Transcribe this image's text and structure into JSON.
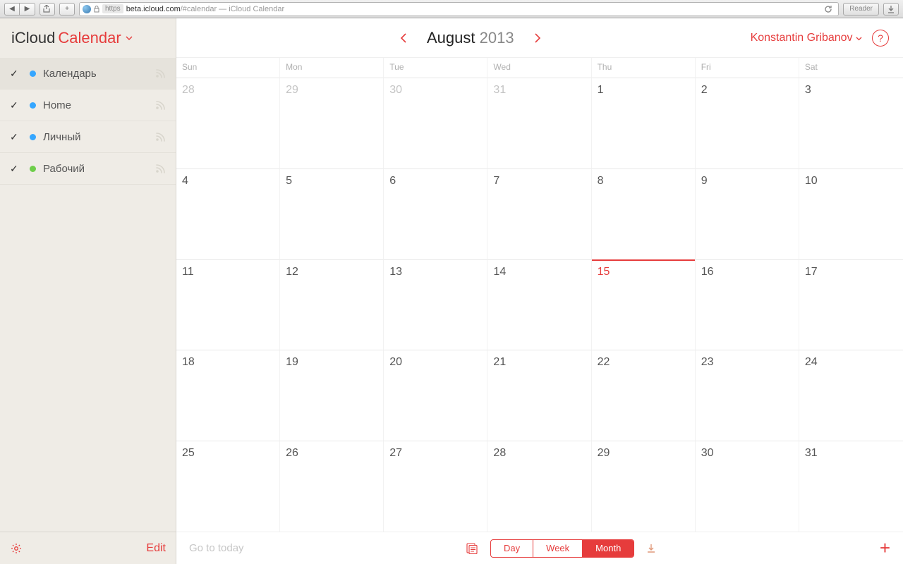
{
  "browser": {
    "scheme": "https",
    "host": "beta.icloud.com",
    "path": "/#calendar",
    "title_suffix": " — iCloud Calendar",
    "reader_label": "Reader"
  },
  "header": {
    "brand": "iCloud",
    "app_name": "Calendar"
  },
  "sidebar": {
    "calendars": [
      {
        "label": "Календарь",
        "color": "blue",
        "checked": true
      },
      {
        "label": "Home",
        "color": "blue",
        "checked": true
      },
      {
        "label": "Личный",
        "color": "blue",
        "checked": true
      },
      {
        "label": "Рабочий",
        "color": "green",
        "checked": true
      }
    ],
    "edit_label": "Edit"
  },
  "main": {
    "month": "August",
    "year": "2013",
    "username": "Konstantin Gribanov",
    "help": "?",
    "dow": [
      "Sun",
      "Mon",
      "Tue",
      "Wed",
      "Thu",
      "Fri",
      "Sat"
    ],
    "go_today": "Go to today",
    "views": {
      "day": "Day",
      "week": "Week",
      "month": "Month",
      "active": "month"
    },
    "grid": [
      {
        "n": "28",
        "other": true
      },
      {
        "n": "29",
        "other": true
      },
      {
        "n": "30",
        "other": true
      },
      {
        "n": "31",
        "other": true
      },
      {
        "n": "1"
      },
      {
        "n": "2"
      },
      {
        "n": "3"
      },
      {
        "n": "4"
      },
      {
        "n": "5"
      },
      {
        "n": "6"
      },
      {
        "n": "7"
      },
      {
        "n": "8"
      },
      {
        "n": "9"
      },
      {
        "n": "10"
      },
      {
        "n": "11"
      },
      {
        "n": "12"
      },
      {
        "n": "13"
      },
      {
        "n": "14"
      },
      {
        "n": "15",
        "today": true
      },
      {
        "n": "16"
      },
      {
        "n": "17"
      },
      {
        "n": "18"
      },
      {
        "n": "19"
      },
      {
        "n": "20"
      },
      {
        "n": "21"
      },
      {
        "n": "22"
      },
      {
        "n": "23"
      },
      {
        "n": "24"
      },
      {
        "n": "25"
      },
      {
        "n": "26"
      },
      {
        "n": "27"
      },
      {
        "n": "28"
      },
      {
        "n": "29"
      },
      {
        "n": "30"
      },
      {
        "n": "31"
      }
    ]
  }
}
